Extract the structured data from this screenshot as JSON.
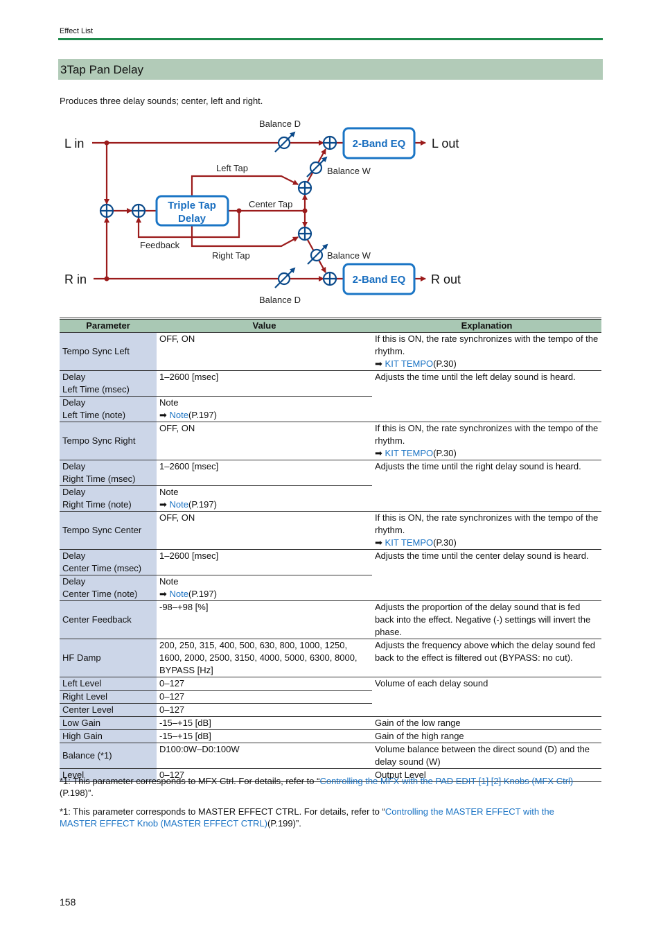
{
  "header": {
    "section": "Effect List"
  },
  "title": "3Tap Pan Delay",
  "intro": "Produces three delay sounds; center, left and right.",
  "diagram": {
    "l_in": "L in",
    "r_in": "R in",
    "l_out": "L out",
    "r_out": "R out",
    "eq_label": "2-Band EQ",
    "delay_line1": "Triple Tap",
    "delay_line2": "Delay",
    "balance_d": "Balance D",
    "balance_w": "Balance W",
    "left_tap": "Left Tap",
    "center_tap": "Center Tap",
    "right_tap": "Right Tap",
    "feedback": "Feedback",
    "colors": {
      "signal": "#9b1b1b",
      "node": "#0b4a8a",
      "box": "#1a75c5"
    }
  },
  "table": {
    "headers": [
      "Parameter",
      "Value",
      "Explanation"
    ],
    "rows": [
      {
        "param": "Tempo Sync Left",
        "value": "OFF, ON",
        "expl": "If this is ON, the rate synchronizes with the tempo of the rhythm.",
        "link": "KIT TEMPO",
        "ref": "(P.30)"
      },
      {
        "param1": "Delay",
        "param2": "Left Time (msec)",
        "value": "1–2600 [msec]",
        "expl": "Adjusts the time until the left delay sound is heard."
      },
      {
        "param1": "Delay",
        "param2": "Left Time (note)",
        "value": "Note",
        "link": "Note",
        "ref": "(P.197)"
      },
      {
        "param": "Tempo Sync Right",
        "value": "OFF, ON",
        "expl": "If this is ON, the rate synchronizes with the tempo of the rhythm.",
        "link": "KIT TEMPO",
        "ref": "(P.30)"
      },
      {
        "param1": "Delay",
        "param2": "Right Time (msec)",
        "value": "1–2600 [msec]",
        "expl": "Adjusts the time until the right delay sound is heard."
      },
      {
        "param1": "Delay",
        "param2": "Right Time (note)",
        "value": "Note",
        "link": "Note",
        "ref": "(P.197)"
      },
      {
        "param": "Tempo Sync Center",
        "value": "OFF, ON",
        "expl": "If this is ON, the rate synchronizes with the tempo of the rhythm.",
        "link": "KIT TEMPO",
        "ref": "(P.30)"
      },
      {
        "param1": "Delay",
        "param2": "Center Time (msec)",
        "value": "1–2600 [msec]",
        "expl": "Adjusts the time until the center delay sound is heard."
      },
      {
        "param1": "Delay",
        "param2": "Center Time (note)",
        "value": "Note",
        "link": "Note",
        "ref": "(P.197)"
      },
      {
        "param": "Center Feedback",
        "value": "-98–+98 [%]",
        "expl": "Adjusts the proportion of the delay sound that is fed back into the effect. Negative (-) settings will invert the phase."
      },
      {
        "param": "HF Damp",
        "value": "200, 250, 315, 400, 500, 630, 800, 1000, 1250, 1600, 2000, 2500, 3150, 4000, 5000, 6300, 8000, BYPASS [Hz]",
        "expl": "Adjusts the frequency above which the delay sound fed back to the effect is filtered out (BYPASS: no cut)."
      },
      {
        "param": "Left Level",
        "value": "0–127",
        "expl": "Volume of each delay sound"
      },
      {
        "param": "Right Level",
        "value": "0–127"
      },
      {
        "param": "Center Level",
        "value": "0–127"
      },
      {
        "param": "Low Gain",
        "value": "-15–+15 [dB]",
        "expl": "Gain of the low range"
      },
      {
        "param": "High Gain",
        "value": "-15–+15 [dB]",
        "expl": "Gain of the high range"
      },
      {
        "param": "Balance (*1)",
        "value": "D100:0W–D0:100W",
        "expl": "Volume balance between the direct sound (D) and the delay sound (W)"
      },
      {
        "param": "Level",
        "value": "0–127",
        "expl": "Output Level"
      }
    ]
  },
  "footnotes": [
    {
      "pre": "*1: This parameter corresponds to MFX Ctrl. For details, refer to “",
      "link": "Controlling the MFX with the PAD EDIT [1] [2] Knobs (MFX Ctrl)",
      "post": "(P.198)”."
    },
    {
      "pre": "*1: This parameter corresponds to MASTER EFFECT CTRL. For details, refer to “",
      "link": "Controlling the MASTER EFFECT with the MASTER EFFECT Knob (MASTER EFFECT CTRL)",
      "post": "(P.199)”."
    }
  ],
  "page_number": "158"
}
